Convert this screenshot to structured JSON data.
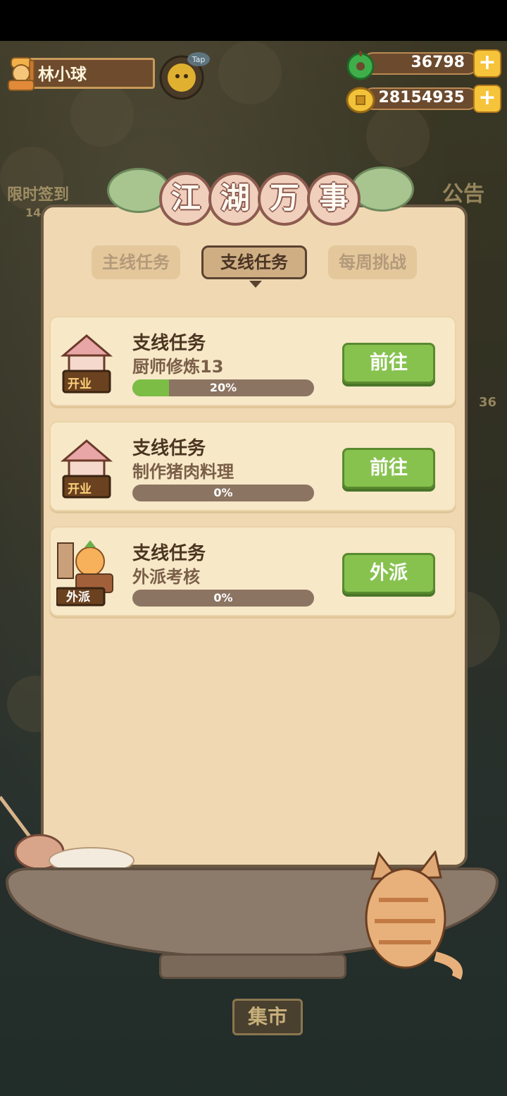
{
  "player": {
    "name": "林小球"
  },
  "currencies": {
    "jade": {
      "value": "36798",
      "icon": "jade-icon"
    },
    "coins": {
      "value": "28154935",
      "icon": "coin-icon"
    }
  },
  "background": {
    "left_label": "限时签到",
    "right_label": "公告",
    "left_count": "14",
    "right_count": "36",
    "market_label": "集市"
  },
  "dialog": {
    "title_chars": [
      "江",
      "湖",
      "万",
      "事"
    ],
    "tabs": [
      {
        "label": "主线任务",
        "active": false
      },
      {
        "label": "支线任务",
        "active": true
      },
      {
        "label": "每周挑战",
        "active": false
      }
    ],
    "tasks": [
      {
        "title": "支线任务",
        "desc": "厨师修炼13",
        "progress": 0.2,
        "progress_text": "20%",
        "button": "前往",
        "badge": "开业"
      },
      {
        "title": "支线任务",
        "desc": "制作猪肉料理",
        "progress": 0.0,
        "progress_text": "0%",
        "button": "前往",
        "badge": "开业"
      },
      {
        "title": "支线任务",
        "desc": "外派考核",
        "progress": 0.0,
        "progress_text": "0%",
        "button": "外派",
        "badge": "外派"
      }
    ]
  },
  "colors": {
    "panel": "#f0d9b2",
    "button_green": "#87c24f",
    "progress_fill": "#7bbd45",
    "title_pink": "#f1cfbd"
  }
}
